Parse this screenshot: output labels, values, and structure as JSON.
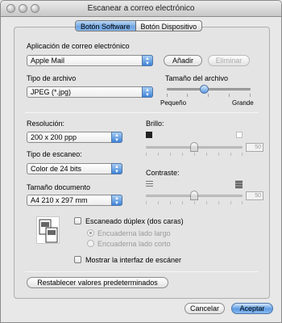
{
  "window": {
    "title": "Escanear a correo electrónico"
  },
  "tabs": [
    {
      "label": "Botón Software",
      "active": true
    },
    {
      "label": "Botón Dispositivo",
      "active": false
    }
  ],
  "email_app": {
    "label": "Aplicación de correo electrónico",
    "value": "Apple Mail",
    "add_label": "Añadir",
    "remove_label": "Eliminar"
  },
  "file_type": {
    "label": "Tipo de archivo",
    "value": "JPEG (*.jpg)"
  },
  "file_size": {
    "label": "Tamaño del archivo",
    "min_label": "Pequeño",
    "max_label": "Grande",
    "level": 0.45
  },
  "resolution": {
    "label": "Resolución:",
    "value": "200 x 200 ppp"
  },
  "scan_type": {
    "label": "Tipo de escaneo:",
    "value": "Color de 24 bits"
  },
  "doc_size": {
    "label": "Tamaño documento",
    "value": "A4  210 x 297 mm"
  },
  "brightness": {
    "label": "Brillo:",
    "value": "50",
    "level": 0.5
  },
  "contrast": {
    "label": "Contraste:",
    "value": "50",
    "level": 0.5
  },
  "duplex": {
    "label": "Escaneado dúplex (dos caras)",
    "options": [
      "Encuaderna lado largo",
      "Encuaderna lado corto"
    ],
    "checked": false
  },
  "show_ui": {
    "label": "Mostrar la interfaz de escáner",
    "checked": false
  },
  "reset_label": "Restablecer valores predeterminados",
  "cancel_label": "Cancelar",
  "ok_label": "Aceptar",
  "colors": {
    "accent": "#5c9be4"
  }
}
